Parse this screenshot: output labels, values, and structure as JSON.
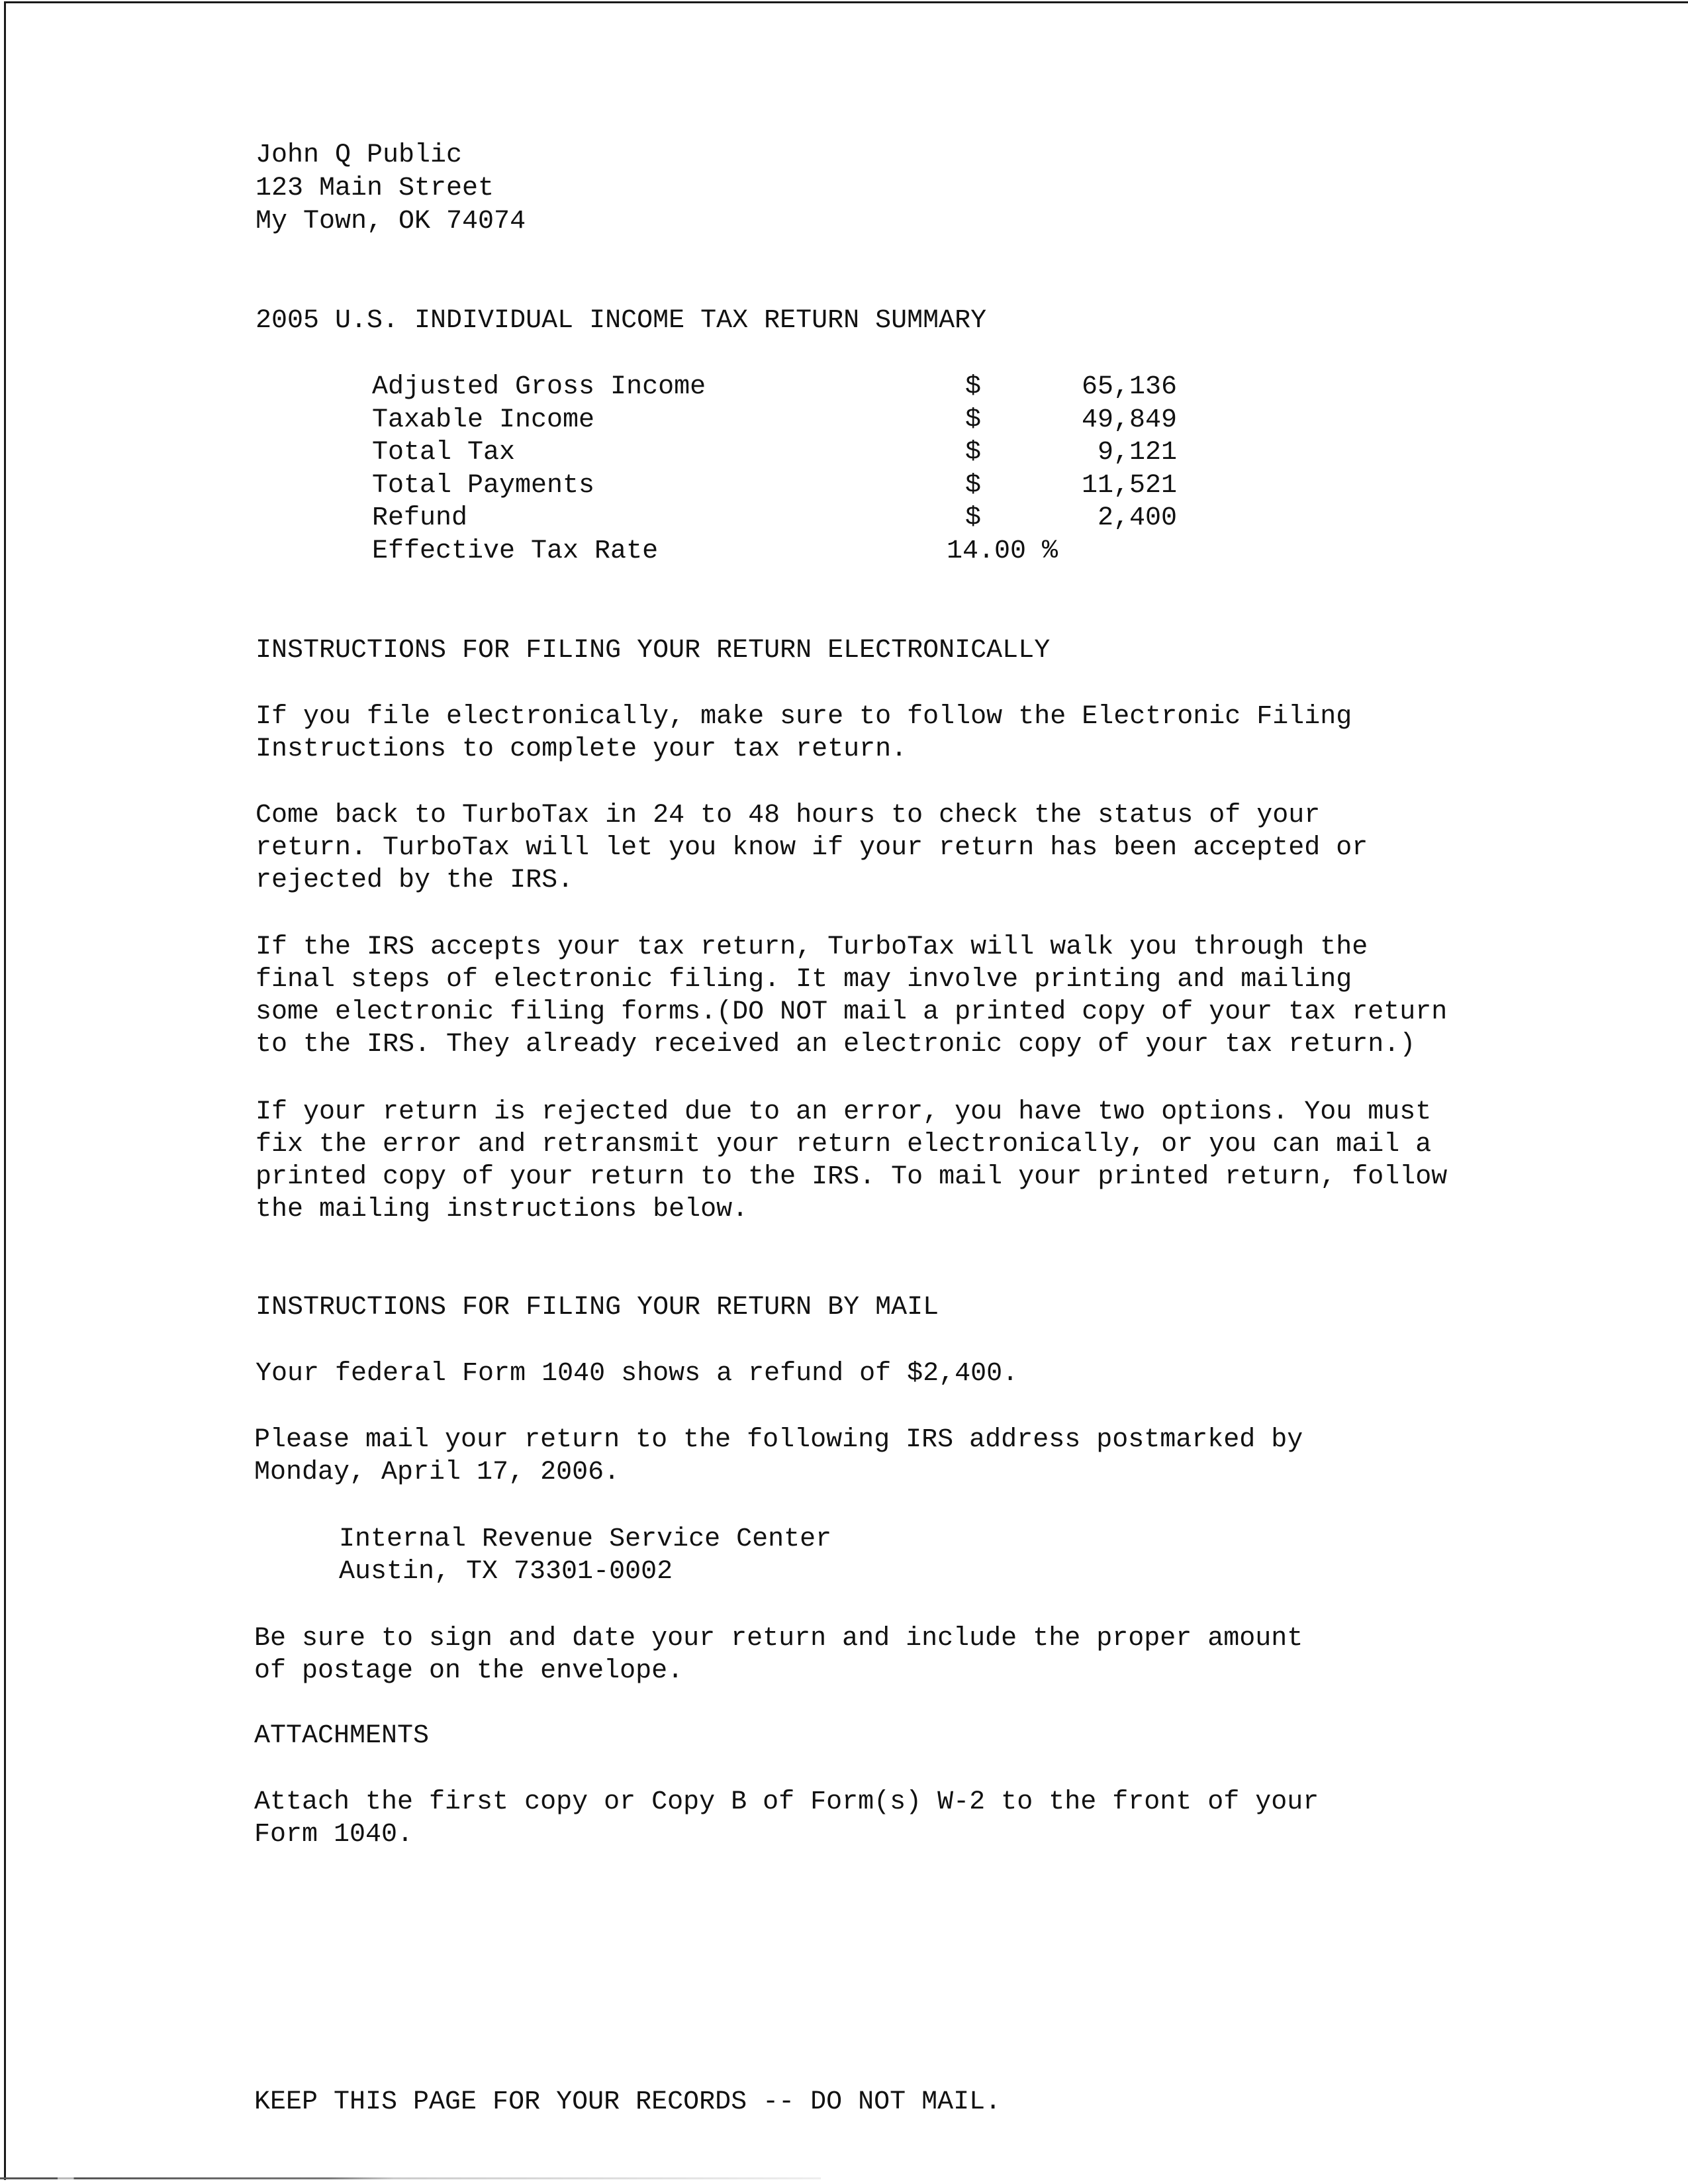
{
  "address": {
    "name": "John Q Public",
    "street": "123 Main Street",
    "city_state_zip": "My Town, OK 74074"
  },
  "summary": {
    "heading": "2005 U.S. INDIVIDUAL INCOME TAX RETURN SUMMARY",
    "rows": [
      {
        "label": "Adjusted Gross Income",
        "currency": "$",
        "amount": "65,136"
      },
      {
        "label": "Taxable Income",
        "currency": "$",
        "amount": "49,849"
      },
      {
        "label": "Total Tax",
        "currency": "$",
        "amount": "9,121"
      },
      {
        "label": "Total Payments",
        "currency": "$",
        "amount": "11,521"
      },
      {
        "label": "Refund",
        "currency": "$",
        "amount": "2,400"
      }
    ],
    "rate": {
      "label": "Effective Tax Rate",
      "value": "14.00 %"
    }
  },
  "electronic": {
    "heading": "INSTRUCTIONS FOR FILING YOUR RETURN ELECTRONICALLY",
    "p1": [
      "If you file electronically, make sure to follow the Electronic Filing",
      "Instructions to complete your tax return."
    ],
    "p2": [
      "Come back to TurboTax in 24 to 48 hours to check the status of your",
      "return. TurboTax will let you know if your return has been accepted or",
      "rejected by the IRS."
    ],
    "p3": [
      "If the IRS accepts your tax return, TurboTax will walk you through the",
      "final steps of electronic filing. It may involve printing and mailing",
      "some electronic filing forms.(DO NOT mail a printed copy of your tax return",
      "to the IRS. They already received an electronic copy of your tax return.)"
    ],
    "p4": [
      "If your return is rejected due to an error, you have two options. You must",
      "fix the error and retransmit your return electronically, or you can mail a",
      "printed copy of your return to the IRS. To mail your printed return, follow",
      "the mailing instructions below."
    ]
  },
  "mail": {
    "heading": "INSTRUCTIONS FOR FILING YOUR RETURN BY MAIL",
    "refund_line": "Your federal Form 1040 shows a refund of $2,400.",
    "p_mail": [
      "Please mail your return to the following IRS address postmarked by",
      "Monday, April 17, 2006."
    ],
    "irs_address": [
      "Internal Revenue Service Center",
      "Austin, TX 73301-0002"
    ],
    "p_sign": [
      "Be sure to sign and date your return and include the proper amount",
      "of postage on the envelope."
    ]
  },
  "attachments": {
    "heading": "ATTACHMENTS",
    "p": [
      "Attach the first copy or Copy B of Form(s) W-2 to the front of your",
      "Form 1040."
    ]
  },
  "footer": {
    "note": "KEEP THIS PAGE FOR YOUR RECORDS -- DO NOT MAIL."
  }
}
